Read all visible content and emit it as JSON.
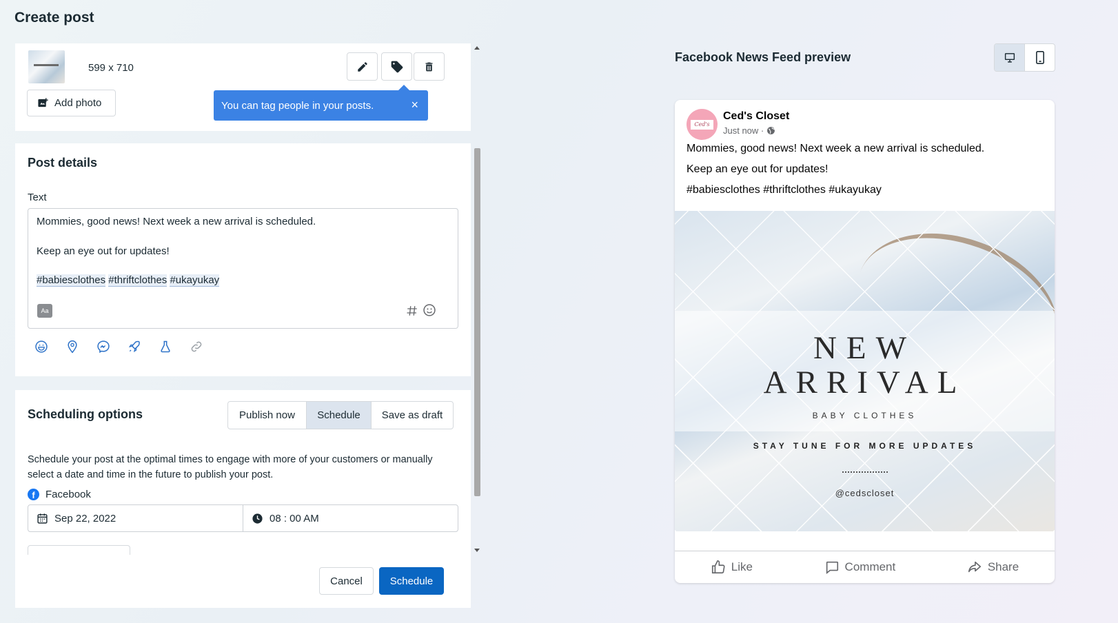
{
  "page": {
    "title": "Create post"
  },
  "media": {
    "dimensions": "599 x 710",
    "add_photo_label": "Add photo",
    "tooltip_text": "You can tag people in your posts.",
    "tooltip_close": "×",
    "icons": [
      "pencil-icon",
      "tag-icon",
      "trash-icon"
    ]
  },
  "post_details": {
    "title": "Post details",
    "text_label": "Text",
    "line1": "Mommies, good news! Next week a new arrival is scheduled.",
    "line2": "Keep an eye out for updates!",
    "hashtags": [
      "#babiesclothes",
      "#thriftclothes",
      "#ukayukay"
    ],
    "aa_label": "Aa",
    "toolbar_icons": [
      "feeling-icon",
      "location-icon",
      "messenger-icon",
      "boost-icon",
      "test-icon",
      "link-icon"
    ]
  },
  "scheduling": {
    "title": "Scheduling options",
    "options": [
      "Publish now",
      "Schedule",
      "Save as draft"
    ],
    "selected": "Schedule",
    "description": "Schedule your post at the optimal times to engage with more of your customers or manually select a date and time in the future to publish your post.",
    "platform": "Facebook",
    "date": "Sep 22, 2022",
    "time": "08 : 00 AM"
  },
  "footer": {
    "cancel_label": "Cancel",
    "schedule_label": "Schedule"
  },
  "preview": {
    "title": "Facebook News Feed preview",
    "page_name": "Ced's Closet",
    "avatar_text": "Ced's",
    "timestamp": "Just now ·",
    "text_line1": "Mommies, good news! Next week a new arrival is scheduled.",
    "text_line2": "Keep an eye out for updates!",
    "text_line3": "#babiesclothes #thriftclothes #ukayukay",
    "image": {
      "line1": "NEW",
      "line2": "ARRIVAL",
      "line3": "BABY CLOTHES",
      "line4": "STAY TUNE FOR MORE UPDATES",
      "handle": "@cedscloset"
    },
    "actions": {
      "like": "Like",
      "comment": "Comment",
      "share": "Share"
    }
  },
  "colors": {
    "accent": "#0a66c2",
    "tooltip": "#3b82e4",
    "facebook": "#1877f2"
  }
}
